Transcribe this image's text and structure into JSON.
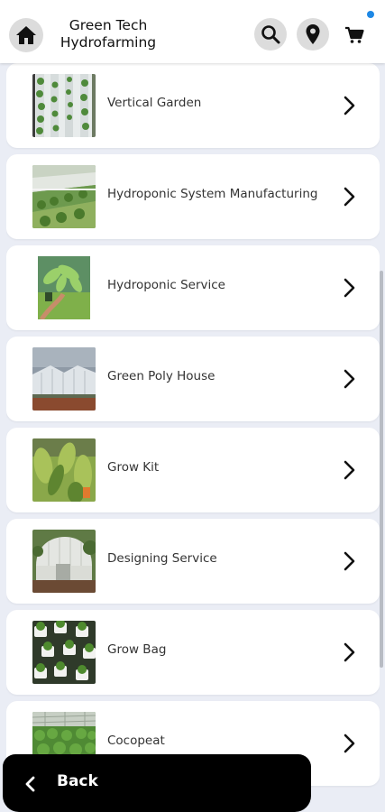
{
  "header": {
    "title_line1": "Green Tech",
    "title_line2": "Hydrofarming",
    "home_icon": "home-icon",
    "search_icon": "search-icon",
    "location_icon": "location-pin-icon",
    "cart_icon": "cart-icon",
    "notification_dot_color": "#1e88e5"
  },
  "categories": [
    {
      "label": "Vertical Garden"
    },
    {
      "label": "Hydroponic System Manufacturing"
    },
    {
      "label": "Hydroponic Service"
    },
    {
      "label": "Green Poly House"
    },
    {
      "label": "Grow Kit"
    },
    {
      "label": "Designing Service"
    },
    {
      "label": "Grow Bag"
    },
    {
      "label": "Cocopeat"
    }
  ],
  "footer": {
    "back_label": "Back",
    "back_icon": "chevron-left-icon"
  },
  "colors": {
    "background": "#eaedf5",
    "card": "#ffffff",
    "footer": "#000000"
  }
}
